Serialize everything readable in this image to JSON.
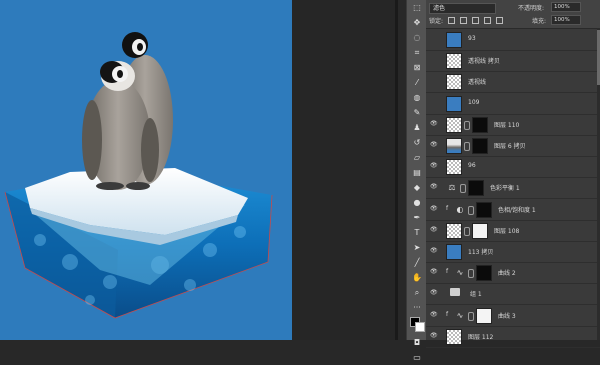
{
  "layers_panel": {
    "blend_mode": "滤色",
    "opacity_label": "不透明度:",
    "opacity_value": "100%",
    "lock_label": "锁定:",
    "fill_label": "填充:",
    "fill_value": "100%",
    "layers": [
      {
        "name": "93",
        "visible": false,
        "thumb": "blue"
      },
      {
        "name": "透视线 拷贝",
        "visible": false,
        "thumb": "checker"
      },
      {
        "name": "透视线",
        "visible": false,
        "thumb": "checker"
      },
      {
        "name": "109",
        "visible": false,
        "thumb": "blue"
      },
      {
        "name": "图层 110",
        "visible": true,
        "thumb": "checker",
        "mask": "black"
      },
      {
        "name": "图层 6 拷贝",
        "visible": true,
        "thumb": "photo",
        "mask": "black"
      },
      {
        "name": "96",
        "visible": true,
        "thumb": "checker"
      },
      {
        "name": "色彩平衡 1",
        "visible": true,
        "adjustment": "balance-icon",
        "mask": "black"
      },
      {
        "name": "色相/饱和度 1",
        "visible": true,
        "adjustment": "hue-icon",
        "mask": "black",
        "clip": "f"
      },
      {
        "name": "图层 108",
        "visible": true,
        "thumb": "checker",
        "mask": "white"
      },
      {
        "name": "113 拷贝",
        "visible": true,
        "thumb": "blue"
      },
      {
        "name": "曲线 2",
        "visible": true,
        "adjustment": "curves-icon",
        "mask": "black",
        "clip": "f"
      },
      {
        "name": "组 1",
        "visible": true,
        "group": true
      },
      {
        "name": "曲线 3",
        "visible": true,
        "adjustment": "curves-icon",
        "mask": "white",
        "clip": "f"
      },
      {
        "name": "图层 112",
        "visible": true,
        "thumb": "checker"
      }
    ]
  },
  "colors": {
    "canvas_bg": "#2e7bbc",
    "panel_bg": "#3a3a3a"
  }
}
